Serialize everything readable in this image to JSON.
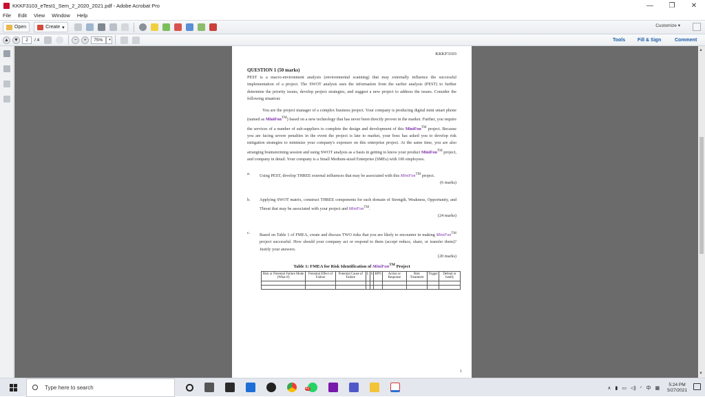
{
  "window": {
    "title": "KKKF3103_eTest1_Sem_2_2020_2021.pdf - Adobe Acrobat Pro",
    "controls": [
      "—",
      "❐",
      "✕"
    ]
  },
  "menu": [
    "File",
    "Edit",
    "View",
    "Window",
    "Help"
  ],
  "toolbar": {
    "open_label": "Open",
    "create_label": "Create",
    "customize_label": "Customize"
  },
  "nav": {
    "page_current": "2",
    "page_total": "/ 4",
    "zoom": "75%"
  },
  "right_tabs": {
    "tools": "Tools",
    "fill_sign": "Fill & Sign",
    "comment": "Comment"
  },
  "doc": {
    "code": "KKKF3103",
    "question_head": "QUESTION 1 (50 marks)",
    "intro": "PEST is a macro-environment analysis (environmental scanning) that may externally influence the successful implementation of a project. The SWOT analysis uses the information from the earlier analysis (PEST) to further determine the priority issues, develop project strategies, and suggest a new project to address the issues. Consider the following situation:",
    "scenario_a": "You are the project manager of a complex business project. Your company is producing digital mini smart phone (named as ",
    "mf_name": "MiniFon",
    "tm": "TM",
    "scenario_b": ") based on a new technology that has never been directly proven in the market. Further, you require the services of a number of sub-suppliers to complete the design and development of this ",
    "scenario_c": " project. Because you are facing severe penalties in the event the project is late to market, your boss has asked you to develop risk mitigation strategies to minimize your company's exposure on this enterprise project. At the same time, you are also arranging brainstorming session and using SWOT analysis as a basis in getting to know your product ",
    "scenario_d": " project, and company in detail. Your company is a Small Medium-sized Enterprise (SMEs) with 100 employees.",
    "items": [
      {
        "label": "a.",
        "text_a": "Using PEST, develop THREE external influences that may be associated with this ",
        "text_b": " project.",
        "marks": "(6 marks)"
      },
      {
        "label": "b.",
        "text_a": "Applying SWOT matrix, construct THREE components for each domain of Strength, Weakness, Opportunity, and Threat that may be associated with your project and ",
        "text_b": ".",
        "marks": "(24 marks)"
      },
      {
        "label": "c.",
        "text_a": "Based on Table 1 of FMEA, create and discuss TWO risks that you are likely to encounter in making ",
        "text_b": " project successful. How should your company act or respond to them (accept reduce, share, or transfer them)? Justify your answers.",
        "marks": "(20 marks)"
      }
    ],
    "table_caption_a": "Table 1: FMEA for Risk Identification of ",
    "table_caption_b": " Project",
    "table_headers": [
      "Risk or Potential Failure Mode (What if)",
      "Potential Effect of Failure",
      "Potential Cause of Failure",
      "L",
      "S",
      "RPN",
      "Action or Response",
      "Risk Treatment",
      "Trigger",
      "Defend or Justify"
    ],
    "page_number": "1"
  },
  "taskbar": {
    "search_placeholder": "Type here to search",
    "time": "5:24 PM",
    "date": "5/27/2021",
    "ime": "中",
    "badge": "41"
  }
}
